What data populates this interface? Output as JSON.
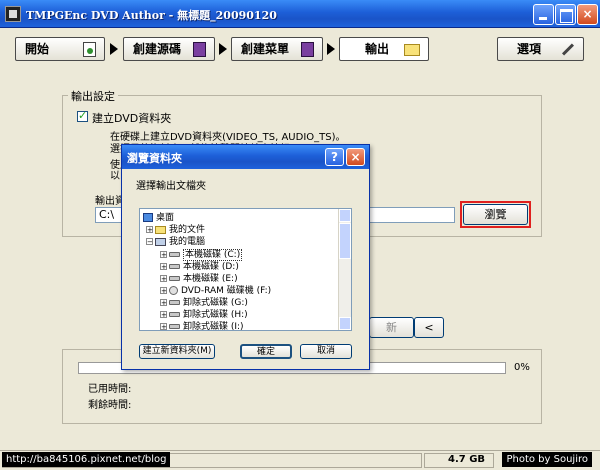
{
  "window": {
    "title": "TMPGEnc DVD Author - 無標題_20090120",
    "minimize_glyph": "_",
    "maximize_glyph": "□",
    "close_glyph": "×"
  },
  "steps": [
    {
      "label": "開始",
      "icon": "page-icon"
    },
    {
      "label": "創建源碼",
      "icon": "cube-icon"
    },
    {
      "label": "創建菜單",
      "icon": "menu-icon"
    },
    {
      "label": "輸出",
      "icon": "folder-icon"
    }
  ],
  "options_button": {
    "label": "選項",
    "icon": "wrench-icon"
  },
  "output_settings": {
    "group_title": "輸出設定",
    "checkbox_label": "建立DVD資料夾",
    "checkbox_checked": true,
    "desc_line1": "在硬碟上建立DVD資料夾(VIDEO_TS, AUDIO_TS)。",
    "desc_line2": "選擇目的資料夾，然後按擊開始輸出按鈕。",
    "desc_line3": "使用DV",
    "desc_line4": "以DVD-",
    "output_label": "輸出資",
    "output_path": "C:\\",
    "browse_label": "瀏覽"
  },
  "behind_buttons": {
    "next_label": "新",
    "back_glyph": "<"
  },
  "progress": {
    "percent_label": "0%",
    "percent": 0,
    "elapsed_label": "已用時間:",
    "remaining_label": "剩餘時間:"
  },
  "dialog": {
    "title": "瀏覽資料夾",
    "help_glyph": "?",
    "close_glyph": "×",
    "prompt": "選擇輸出文檔夾",
    "tree": [
      {
        "label": "桌面",
        "icon": "desktop-icon",
        "indent": 0,
        "expander": ""
      },
      {
        "label": "我的文件",
        "icon": "my-documents-icon",
        "indent": 1,
        "expander": "+"
      },
      {
        "label": "我的電腦",
        "icon": "my-computer-icon",
        "indent": 1,
        "expander": "−"
      },
      {
        "label": "本機磁碟 (C:)",
        "icon": "drive-icon",
        "indent": 2,
        "expander": "+"
      },
      {
        "label": "本機磁碟 (D:)",
        "icon": "drive-icon",
        "indent": 2,
        "expander": "+"
      },
      {
        "label": "本機磁碟 (E:)",
        "icon": "drive-icon",
        "indent": 2,
        "expander": "+"
      },
      {
        "label": "DVD-RAM 磁碟機 (F:)",
        "icon": "dvd-drive-icon",
        "indent": 2,
        "expander": "+"
      },
      {
        "label": "卸除式磁碟 (G:)",
        "icon": "drive-icon",
        "indent": 2,
        "expander": "+"
      },
      {
        "label": "卸除式磁碟 (H:)",
        "icon": "drive-icon",
        "indent": 2,
        "expander": "+"
      },
      {
        "label": "卸除式磁碟 (I:)",
        "icon": "drive-icon",
        "indent": 2,
        "expander": "+"
      }
    ],
    "new_folder_label": "建立新資料夾(M)",
    "ok_label": "確定",
    "cancel_label": "取消"
  },
  "statusbar": {
    "url": "http://ba845106.pixnet.net/blog",
    "size": "4.7 GB",
    "credit": "Photo by Soujiro"
  }
}
